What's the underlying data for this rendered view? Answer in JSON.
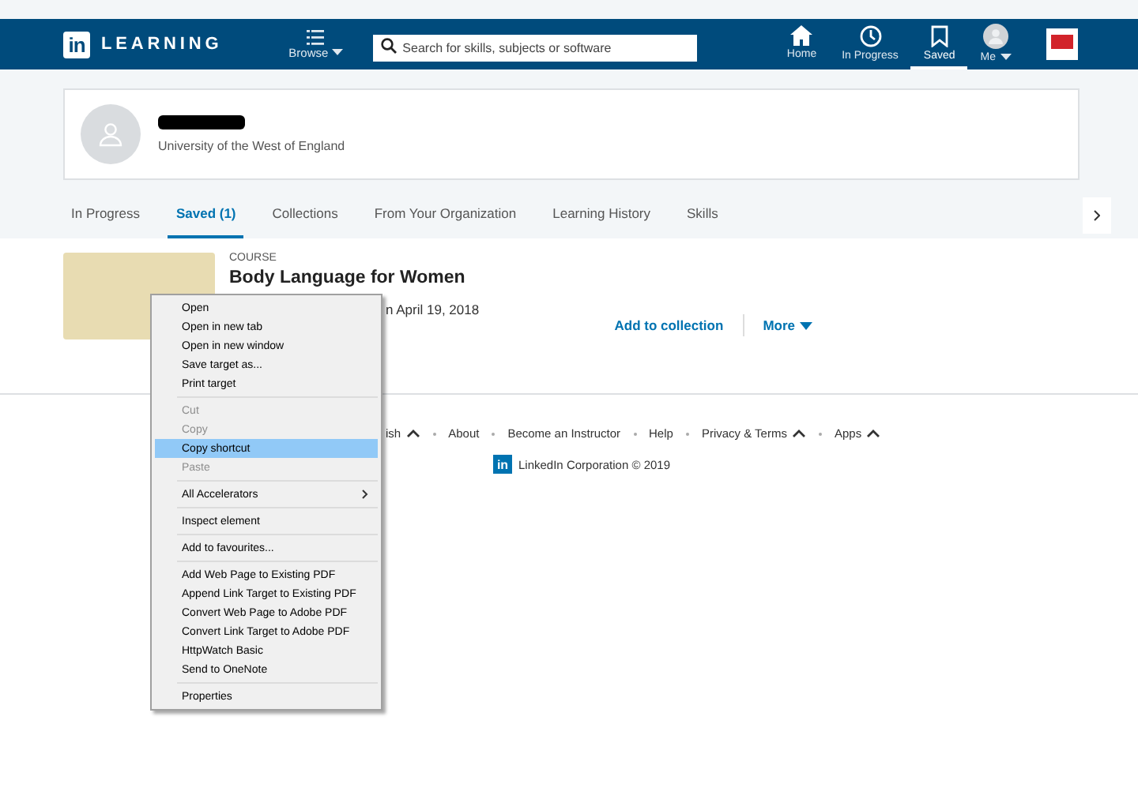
{
  "nav": {
    "logo_mark": "in",
    "logo_text": "LEARNING",
    "browse": "Browse",
    "search": {
      "placeholder": "Search for skills, subjects or software"
    },
    "items": [
      {
        "label": "Home",
        "selected": false
      },
      {
        "label": "In Progress",
        "selected": false
      },
      {
        "label": "Saved",
        "selected": true
      },
      {
        "label": "Me",
        "selected": false
      }
    ]
  },
  "profile": {
    "subtitle": "University of the West of England"
  },
  "tabs": [
    {
      "label": "In Progress",
      "selected": false
    },
    {
      "label": "Saved (1)",
      "selected": true
    },
    {
      "label": "Collections",
      "selected": false
    },
    {
      "label": "From Your Organization",
      "selected": false
    },
    {
      "label": "Learning History",
      "selected": false
    },
    {
      "label": "Skills",
      "selected": false
    }
  ],
  "course": {
    "type": "COURSE",
    "title": "Body Language for Women",
    "saved": "n April 19, 2018",
    "actions": [
      "Add to collection",
      "More"
    ]
  },
  "footer": {
    "links": [
      {
        "label": "ish",
        "caret": true
      },
      {
        "label": "About",
        "caret": false
      },
      {
        "label": "Become an Instructor",
        "caret": false
      },
      {
        "label": "Help",
        "caret": false
      },
      {
        "label": "Privacy & Terms",
        "caret": true
      },
      {
        "label": "Apps",
        "caret": true
      }
    ],
    "logo_mark": "in",
    "copyright": "LinkedIn Corporation © 2019"
  },
  "context_menu": {
    "groups": [
      [
        {
          "label": "Open",
          "kind": "action",
          "disabled": false,
          "selected": false
        },
        {
          "label": "Open in new tab",
          "kind": "action",
          "disabled": false,
          "selected": false
        },
        {
          "label": "Open in new window",
          "kind": "action",
          "disabled": false,
          "selected": false
        },
        {
          "label": "Save target as...",
          "kind": "action",
          "disabled": false,
          "selected": false
        },
        {
          "label": "Print target",
          "kind": "action",
          "disabled": false,
          "selected": false
        }
      ],
      [
        {
          "label": "Cut",
          "kind": "action",
          "disabled": true,
          "selected": false
        },
        {
          "label": "Copy",
          "kind": "action",
          "disabled": true,
          "selected": false
        },
        {
          "label": "Copy shortcut",
          "kind": "action",
          "disabled": false,
          "selected": true
        },
        {
          "label": "Paste",
          "kind": "action",
          "disabled": true,
          "selected": false
        }
      ],
      [
        {
          "label": "All Accelerators",
          "kind": "submenu",
          "disabled": false,
          "selected": false
        }
      ],
      [
        {
          "label": "Inspect element",
          "kind": "action",
          "disabled": false,
          "selected": false
        }
      ],
      [
        {
          "label": "Add to favourites...",
          "kind": "action",
          "disabled": false,
          "selected": false
        }
      ],
      [
        {
          "label": "Add Web Page to Existing PDF",
          "kind": "action",
          "disabled": false,
          "selected": false
        },
        {
          "label": "Append Link Target to Existing PDF",
          "kind": "action",
          "disabled": false,
          "selected": false
        },
        {
          "label": "Convert Web Page to Adobe PDF",
          "kind": "action",
          "disabled": false,
          "selected": false
        },
        {
          "label": "Convert Link Target to Adobe PDF",
          "kind": "action",
          "disabled": false,
          "selected": false
        },
        {
          "label": "HttpWatch Basic",
          "kind": "action",
          "disabled": false,
          "selected": false
        },
        {
          "label": "Send to OneNote",
          "kind": "action",
          "disabled": false,
          "selected": false
        }
      ],
      [
        {
          "label": "Properties",
          "kind": "action",
          "disabled": false,
          "selected": false
        }
      ]
    ]
  }
}
